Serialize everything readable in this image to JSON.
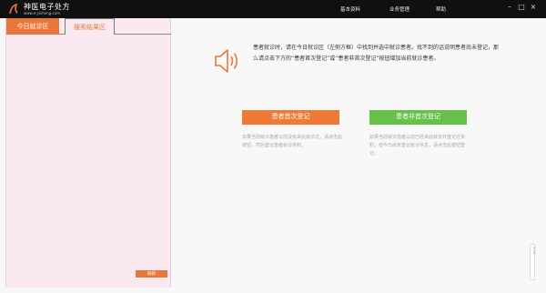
{
  "app": {
    "name": "神医电子处方",
    "url": "www.e-yisheng.com"
  },
  "menu": {
    "items": [
      "基本资料",
      "业务管理",
      "帮助"
    ]
  },
  "window_controls": [
    "–",
    "□",
    "×"
  ],
  "tabs": {
    "today": "今日就诊区",
    "search_results": "搜索结果区"
  },
  "left_panel": {
    "refresh_label": "刷新"
  },
  "main": {
    "info_text": "患者就诊时，请在今日就诊区（左侧方框）中找到并选中就诊患者。找不到的话说明患者尚未登记，那么请点击下方的“患者首次登记”或“患者非首次登记”按钮增加当前就诊患者。",
    "btn_first": "患者首次登记",
    "btn_not_first": "患者非首次登记",
    "note_first": "如果当前就诊患者以前没有来此就诊过，请点击此按钮，然后登记患者就诊资料。",
    "note_not_first": "如果当前就诊患者以前已经来此就诊并登记过资料，但今日尚未登记就诊信息，请点击此按钮登记。"
  },
  "scroll_indicator": "1.00",
  "colors": {
    "accent": "#e8773b",
    "green": "#65c14a",
    "titlebar": "#101010",
    "left_panel_bg": "#fbe9f2"
  }
}
